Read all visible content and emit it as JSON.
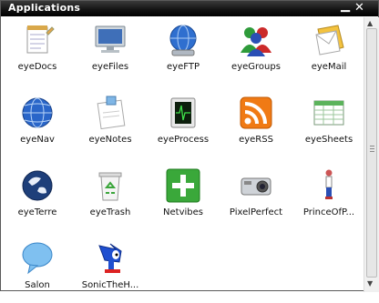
{
  "window": {
    "title": "Applications",
    "minimize_icon": "minimize-icon",
    "close_icon": "close-icon"
  },
  "apps": [
    {
      "label": "eyeDocs",
      "icon": "notepad-icon"
    },
    {
      "label": "eyeFiles",
      "icon": "monitor-icon"
    },
    {
      "label": "eyeFTP",
      "icon": "globe-transfer-icon"
    },
    {
      "label": "eyeGroups",
      "icon": "users-group-icon"
    },
    {
      "label": "eyeMail",
      "icon": "mail-icon"
    },
    {
      "label": "eyeNav",
      "icon": "globe-icon"
    },
    {
      "label": "eyeNotes",
      "icon": "note-icon"
    },
    {
      "label": "eyeProcess",
      "icon": "process-monitor-icon"
    },
    {
      "label": "eyeRSS",
      "icon": "rss-icon"
    },
    {
      "label": "eyeSheets",
      "icon": "spreadsheet-icon"
    },
    {
      "label": "eyeTerre",
      "icon": "earth-icon"
    },
    {
      "label": "eyeTrash",
      "icon": "trash-icon"
    },
    {
      "label": "Netvibes",
      "icon": "plus-icon"
    },
    {
      "label": "PixelPerfect",
      "icon": "camera-icon"
    },
    {
      "label": "PrinceOfP...",
      "icon": "prince-icon"
    },
    {
      "label": "Salon",
      "icon": "chat-bubble-icon"
    },
    {
      "label": "SonicTheH...",
      "icon": "sonic-icon"
    }
  ]
}
